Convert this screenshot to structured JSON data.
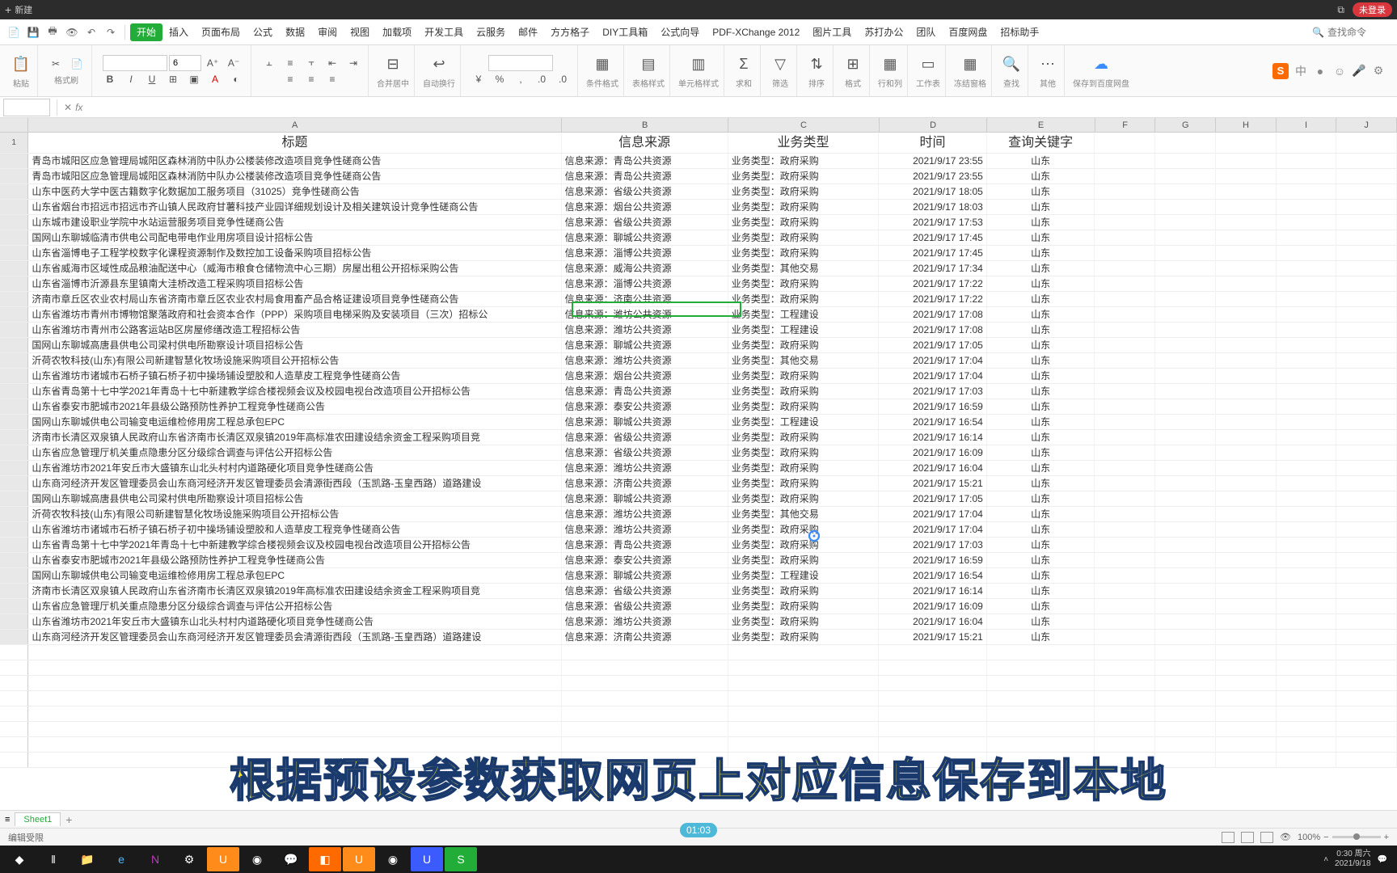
{
  "titlebar": {
    "new": "新建",
    "login": "未登录"
  },
  "menu": {
    "tabs": [
      "开始",
      "插入",
      "页面布局",
      "公式",
      "数据",
      "审阅",
      "视图",
      "加载项",
      "开发工具",
      "云服务",
      "邮件",
      "方方格子",
      "DIY工具箱",
      "公式向导",
      "PDF-XChange 2012",
      "图片工具",
      "苏打办公",
      "团队",
      "百度网盘",
      "招标助手"
    ],
    "search_placeholder": "查找命令"
  },
  "toolbar": {
    "paste": "粘贴",
    "fmt_brush": "格式刷",
    "font_size": "6",
    "cond_fmt": "条件格式",
    "tbl_style": "表格样式",
    "cell_style": "单元格样式",
    "filter": "筛选",
    "sort": "排序",
    "format": "格式",
    "rowcol": "行和列",
    "sheet": "工作表",
    "freeze": "冻结窗格",
    "find": "查找",
    "misc": "其他",
    "baidu": "保存到百度网盘",
    "merge": "合并居中",
    "wrap": "自动换行",
    "sum": "求和"
  },
  "formula": {
    "namebox": "",
    "fx": "fx"
  },
  "columns": [
    "A",
    "B",
    "C",
    "D",
    "E",
    "F",
    "G",
    "H",
    "I",
    "J"
  ],
  "headers": {
    "A": "标题",
    "B": "信息来源",
    "C": "业务类型",
    "D": "时间",
    "E": "查询关键字"
  },
  "rows": [
    {
      "a": "青岛市城阳区应急管理局城阳区森林消防中队办公楼装修改造项目竞争性磋商公告",
      "b": "信息来源：青岛公共资源",
      "c": "业务类型：政府采购",
      "d": "2021/9/17 23:55",
      "e": "山东"
    },
    {
      "a": "青岛市城阳区应急管理局城阳区森林消防中队办公楼装修改造项目竞争性磋商公告",
      "b": "信息来源：青岛公共资源",
      "c": "业务类型：政府采购",
      "d": "2021/9/17 23:55",
      "e": "山东"
    },
    {
      "a": "山东中医药大学中医古籍数字化数据加工服务项目（31025）竞争性磋商公告",
      "b": "信息来源：省级公共资源",
      "c": "业务类型：政府采购",
      "d": "2021/9/17 18:05",
      "e": "山东"
    },
    {
      "a": "山东省烟台市招远市招远市齐山镇人民政府甘薯科技产业园详细规划设计及相关建筑设计竞争性磋商公告",
      "b": "信息来源：烟台公共资源",
      "c": "业务类型：政府采购",
      "d": "2021/9/17 18:03",
      "e": "山东"
    },
    {
      "a": "山东城市建设职业学院中水站运营服务项目竞争性磋商公告",
      "b": "信息来源：省级公共资源",
      "c": "业务类型：政府采购",
      "d": "2021/9/17 17:53",
      "e": "山东"
    },
    {
      "a": "国网山东聊城临清市供电公司配电带电作业用房项目设计招标公告",
      "b": "信息来源：聊城公共资源",
      "c": "业务类型：政府采购",
      "d": "2021/9/17 17:45",
      "e": "山东"
    },
    {
      "a": "山东省淄博电子工程学校数字化课程资源制作及数控加工设备采购项目招标公告",
      "b": "信息来源：淄博公共资源",
      "c": "业务类型：政府采购",
      "d": "2021/9/17 17:45",
      "e": "山东"
    },
    {
      "a": "山东省威海市区域性成品粮油配送中心（威海市粮食仓储物流中心三期）房屋出租公开招标采购公告",
      "b": "信息来源：威海公共资源",
      "c": "业务类型：其他交易",
      "d": "2021/9/17 17:34",
      "e": "山东"
    },
    {
      "a": "山东省淄博市沂源县东里镇南大洼桥改造工程采购项目招标公告",
      "b": "信息来源：淄博公共资源",
      "c": "业务类型：政府采购",
      "d": "2021/9/17 17:22",
      "e": "山东"
    },
    {
      "a": "济南市章丘区农业农村局山东省济南市章丘区农业农村局食用畜产品合格证建设项目竞争性磋商公告",
      "b": "信息来源：济南公共资源",
      "c": "业务类型：政府采购",
      "d": "2021/9/17 17:22",
      "e": "山东"
    },
    {
      "a": "山东省潍坊市青州市博物馆聚落政府和社会资本合作（PPP）采购项目电梯采购及安装项目（三次）招标公",
      "b": "信息来源：潍坊公共资源",
      "c": "业务类型：工程建设",
      "d": "2021/9/17 17:08",
      "e": "山东"
    },
    {
      "a": "山东省潍坊市青州市公路客运站B区房屋修缮改造工程招标公告",
      "b": "信息来源：潍坊公共资源",
      "c": "业务类型：工程建设",
      "d": "2021/9/17 17:08",
      "e": "山东"
    },
    {
      "a": "国网山东聊城高唐县供电公司梁村供电所勘察设计项目招标公告",
      "b": "信息来源：聊城公共资源",
      "c": "业务类型：政府采购",
      "d": "2021/9/17 17:05",
      "e": "山东"
    },
    {
      "a": "沂荷农牧科技(山东)有限公司新建智慧化牧场设施采购项目公开招标公告",
      "b": "信息来源：潍坊公共资源",
      "c": "业务类型：其他交易",
      "d": "2021/9/17 17:04",
      "e": "山东"
    },
    {
      "a": "山东省潍坊市诸城市石桥子镇石桥子初中操场铺设塑胶和人造草皮工程竞争性磋商公告",
      "b": "信息来源：烟台公共资源",
      "c": "业务类型：政府采购",
      "d": "2021/9/17 17:04",
      "e": "山东"
    },
    {
      "a": "山东省青岛第十七中学2021年青岛十七中新建教学综合楼视频会议及校园电视台改造项目公开招标公告",
      "b": "信息来源：青岛公共资源",
      "c": "业务类型：政府采购",
      "d": "2021/9/17 17:03",
      "e": "山东"
    },
    {
      "a": "山东省泰安市肥城市2021年县级公路预防性养护工程竞争性磋商公告",
      "b": "信息来源：泰安公共资源",
      "c": "业务类型：政府采购",
      "d": "2021/9/17 16:59",
      "e": "山东"
    },
    {
      "a": "国网山东聊城供电公司输变电运维检修用房工程总承包EPC",
      "b": "信息来源：聊城公共资源",
      "c": "业务类型：工程建设",
      "d": "2021/9/17 16:54",
      "e": "山东"
    },
    {
      "a": "济南市长清区双泉镇人民政府山东省济南市长清区双泉镇2019年高标准农田建设结余资金工程采购项目竞",
      "b": "信息来源：省级公共资源",
      "c": "业务类型：政府采购",
      "d": "2021/9/17 16:14",
      "e": "山东"
    },
    {
      "a": "山东省应急管理厅机关重点隐患分区分级综合调查与评估公开招标公告",
      "b": "信息来源：省级公共资源",
      "c": "业务类型：政府采购",
      "d": "2021/9/17 16:09",
      "e": "山东"
    },
    {
      "a": "山东省潍坊市2021年安丘市大盛镇东山北头村村内道路硬化项目竞争性磋商公告",
      "b": "信息来源：潍坊公共资源",
      "c": "业务类型：政府采购",
      "d": "2021/9/17 16:04",
      "e": "山东"
    },
    {
      "a": "山东商河经济开发区管理委员会山东商河经济开发区管理委员会清源街西段（玉凯路-玉皇西路）道路建设",
      "b": "信息来源：济南公共资源",
      "c": "业务类型：政府采购",
      "d": "2021/9/17 15:21",
      "e": "山东"
    },
    {
      "a": "国网山东聊城高唐县供电公司梁村供电所勘察设计项目招标公告",
      "b": "信息来源：聊城公共资源",
      "c": "业务类型：政府采购",
      "d": "2021/9/17 17:05",
      "e": "山东"
    },
    {
      "a": "沂荷农牧科技(山东)有限公司新建智慧化牧场设施采购项目公开招标公告",
      "b": "信息来源：潍坊公共资源",
      "c": "业务类型：其他交易",
      "d": "2021/9/17 17:04",
      "e": "山东"
    },
    {
      "a": "山东省潍坊市诸城市石桥子镇石桥子初中操场铺设塑胶和人造草皮工程竞争性磋商公告",
      "b": "信息来源：潍坊公共资源",
      "c": "业务类型：政府采购",
      "d": "2021/9/17 17:04",
      "e": "山东"
    },
    {
      "a": "山东省青岛第十七中学2021年青岛十七中新建教学综合楼视频会议及校园电视台改造项目公开招标公告",
      "b": "信息来源：青岛公共资源",
      "c": "业务类型：政府采购",
      "d": "2021/9/17 17:03",
      "e": "山东"
    },
    {
      "a": "山东省泰安市肥城市2021年县级公路预防性养护工程竞争性磋商公告",
      "b": "信息来源：泰安公共资源",
      "c": "业务类型：政府采购",
      "d": "2021/9/17 16:59",
      "e": "山东"
    },
    {
      "a": "国网山东聊城供电公司输变电运维检修用房工程总承包EPC",
      "b": "信息来源：聊城公共资源",
      "c": "业务类型：工程建设",
      "d": "2021/9/17 16:54",
      "e": "山东"
    },
    {
      "a": "济南市长清区双泉镇人民政府山东省济南市长清区双泉镇2019年高标准农田建设结余资金工程采购项目竞",
      "b": "信息来源：省级公共资源",
      "c": "业务类型：政府采购",
      "d": "2021/9/17 16:14",
      "e": "山东"
    },
    {
      "a": "山东省应急管理厅机关重点隐患分区分级综合调查与评估公开招标公告",
      "b": "信息来源：省级公共资源",
      "c": "业务类型：政府采购",
      "d": "2021/9/17 16:09",
      "e": "山东"
    },
    {
      "a": "山东省潍坊市2021年安丘市大盛镇东山北头村村内道路硬化项目竞争性磋商公告",
      "b": "信息来源：潍坊公共资源",
      "c": "业务类型：政府采购",
      "d": "2021/9/17 16:04",
      "e": "山东"
    },
    {
      "a": "山东商河经济开发区管理委员会山东商河经济开发区管理委员会清源街西段（玉凯路-玉皇西路）道路建设",
      "b": "信息来源：济南公共资源",
      "c": "业务类型：政府采购",
      "d": "2021/9/17 15:21",
      "e": "山东"
    }
  ],
  "selected_cell": "B12",
  "overlay": "根据预设参数获取网页上对应信息保存到本地",
  "time_badge": "01:03",
  "sheet": {
    "name": "Sheet1"
  },
  "status": {
    "mode": "编辑受限",
    "zoom": "100%"
  },
  "taskbar": {
    "time": "0:30",
    "day": "周六",
    "date": "2021/9/18"
  }
}
